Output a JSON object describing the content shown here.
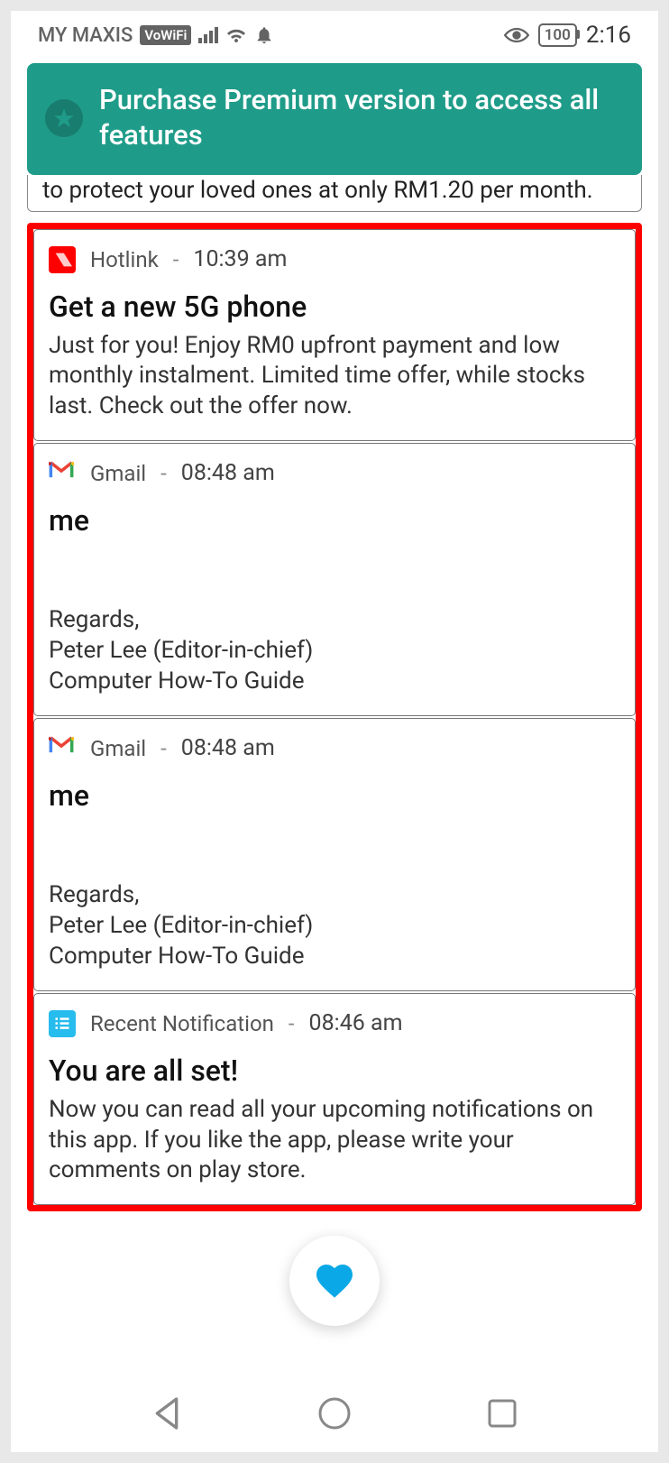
{
  "status": {
    "carrier": "MY MAXIS",
    "vowifi": "VoWiFi",
    "battery": "100",
    "time": "2:16"
  },
  "banner": {
    "text": "Purchase Premium version to access all features"
  },
  "partial_row_text": "to protect your loved ones at only RM1.20 per month.",
  "notifications": [
    {
      "app": "Hotlink",
      "time": "10:39 am",
      "title": "Get a new 5G phone",
      "body": "Just for you! Enjoy RM0 upfront payment and low monthly instalment. Limited time offer, while stocks last. Check out the offer now."
    },
    {
      "app": "Gmail",
      "time": "08:48 am",
      "title": "me",
      "body": "\n\nRegards,\nPeter Lee (Editor-in-chief)\nComputer How-To Guide"
    },
    {
      "app": "Gmail",
      "time": "08:48 am",
      "title": "me",
      "body": "\n\nRegards,\nPeter Lee (Editor-in-chief)\nComputer How-To Guide"
    },
    {
      "app": "Recent Notification",
      "time": "08:46 am",
      "title": "You are all set!",
      "body": "Now you can read all your upcoming notifications on this app. If you like the app, please write your comments on play store."
    }
  ]
}
